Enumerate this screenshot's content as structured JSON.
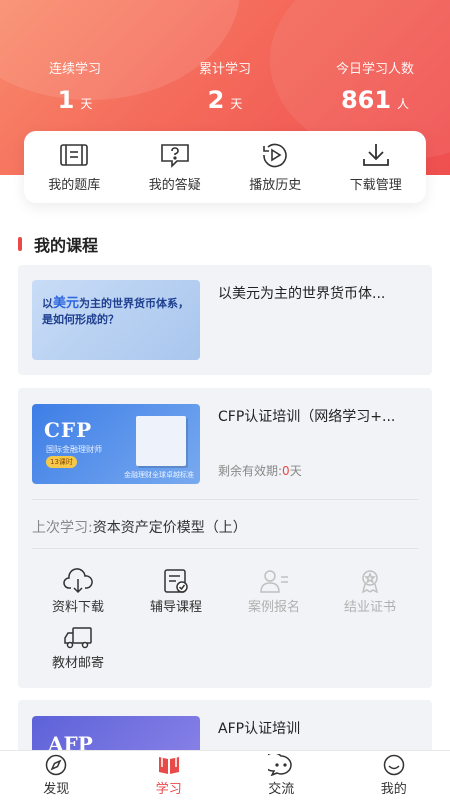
{
  "stats": [
    {
      "label": "连续学习",
      "value": "1",
      "unit": "天"
    },
    {
      "label": "累计学习",
      "value": "2",
      "unit": "天"
    },
    {
      "label": "今日学习人数",
      "value": "861",
      "unit": "人"
    }
  ],
  "quick_links": [
    {
      "label": "我的题库",
      "icon": "question-bank-icon"
    },
    {
      "label": "我的答疑",
      "icon": "qa-icon"
    },
    {
      "label": "播放历史",
      "icon": "play-history-icon"
    },
    {
      "label": "下载管理",
      "icon": "download-icon"
    }
  ],
  "section_title": "我的课程",
  "courses": [
    {
      "title": "以美元为主的世界货币体...",
      "thumb_text_prefix": "以",
      "thumb_text_highlight": "美元",
      "thumb_text_rest": "为主的世界货币体系，",
      "thumb_text_line2": "是如何形成的？"
    },
    {
      "title": "CFP认证培训（网络学习+...",
      "expiry_label": "剩余有效期:",
      "expiry_value": "0",
      "expiry_unit": "天",
      "last_label": "上次学习:",
      "last_value": "资本资产定价模型（上）",
      "thumb_logo": "CFP",
      "thumb_sub": "国际金融理财师",
      "thumb_tag": "13课时",
      "thumb_foot": "金融理财全球卓越标准",
      "actions": [
        {
          "label": "资料下载",
          "icon": "cloud-download-icon",
          "enabled": true
        },
        {
          "label": "辅导课程",
          "icon": "tutoring-icon",
          "enabled": true
        },
        {
          "label": "案例报名",
          "icon": "case-signup-icon",
          "enabled": false
        },
        {
          "label": "结业证书",
          "icon": "certificate-icon",
          "enabled": false
        },
        {
          "label": "教材邮寄",
          "icon": "truck-icon",
          "enabled": true
        }
      ]
    },
    {
      "title": "AFP认证培训",
      "thumb_logo": "AFP"
    }
  ],
  "tabs": [
    {
      "label": "发现",
      "icon": "compass-icon",
      "active": false
    },
    {
      "label": "学习",
      "icon": "book-icon",
      "active": true
    },
    {
      "label": "交流",
      "icon": "chat-icon",
      "active": false
    },
    {
      "label": "我的",
      "icon": "smile-icon",
      "active": false
    }
  ],
  "colors": {
    "accent": "#e84a4a",
    "hero_start": "#f98a6a",
    "hero_end": "#ef4f4f",
    "card_bg": "#f2f3f6"
  }
}
